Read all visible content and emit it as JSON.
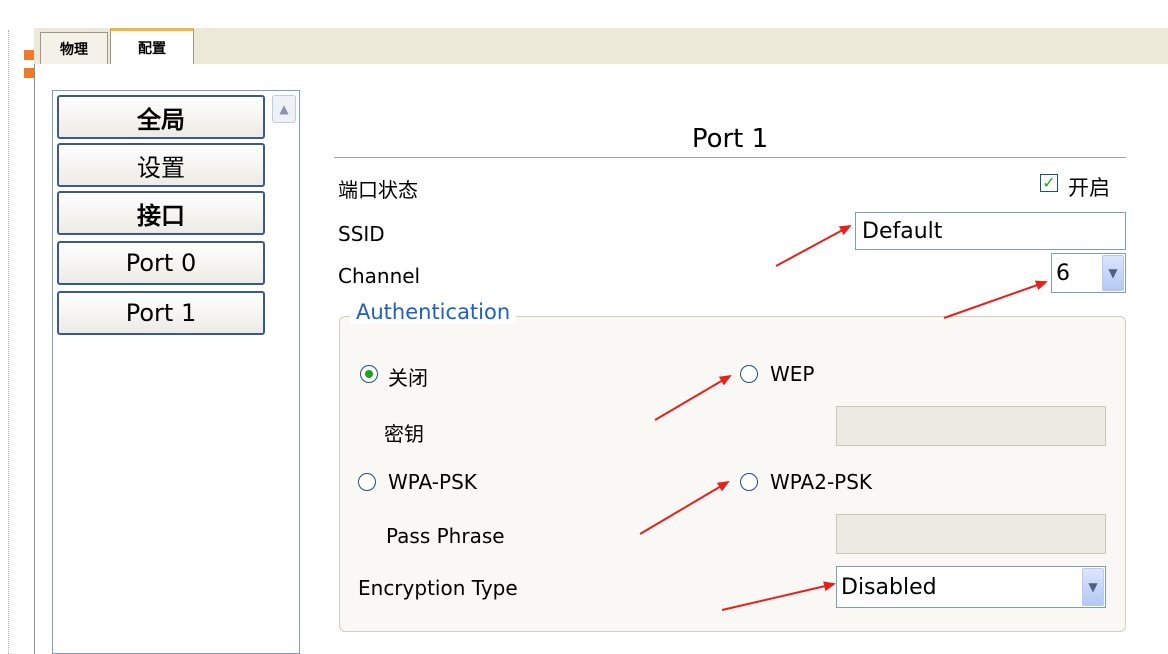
{
  "tabs": [
    {
      "label": "物理",
      "active": false
    },
    {
      "label": "配置",
      "active": true
    }
  ],
  "sidebar": {
    "items": [
      {
        "label": "全局",
        "bold": true
      },
      {
        "label": "设置",
        "bold": false
      },
      {
        "label": "接口",
        "bold": true
      },
      {
        "label": "Port 0",
        "bold": false
      },
      {
        "label": "Port 1",
        "bold": false
      }
    ]
  },
  "port": {
    "title": "Port 1",
    "status_label": "端口状态",
    "status_checkbox_label": "开启",
    "status_checked": true,
    "ssid_label": "SSID",
    "ssid_value": "Default",
    "channel_label": "Channel",
    "channel_value": "6"
  },
  "auth": {
    "legend": "Authentication",
    "options": {
      "off": {
        "label": "关闭",
        "checked": true
      },
      "wep": {
        "label": "WEP",
        "checked": false
      },
      "wpa_psk": {
        "label": "WPA-PSK",
        "checked": false
      },
      "wpa2_psk": {
        "label": "WPA2-PSK",
        "checked": false
      }
    },
    "key_label": "密钥",
    "key_value": "",
    "passphrase_label": "Pass Phrase",
    "passphrase_value": "",
    "encryption_label": "Encryption Type",
    "encryption_value": "Disabled"
  },
  "colors": {
    "accent_legend": "#1f5fc9",
    "annotation_arrow": "#e8201c",
    "check_green": "#21a121",
    "tab_highlight": "#f0b840",
    "orange_marker": "#f07a2a"
  }
}
